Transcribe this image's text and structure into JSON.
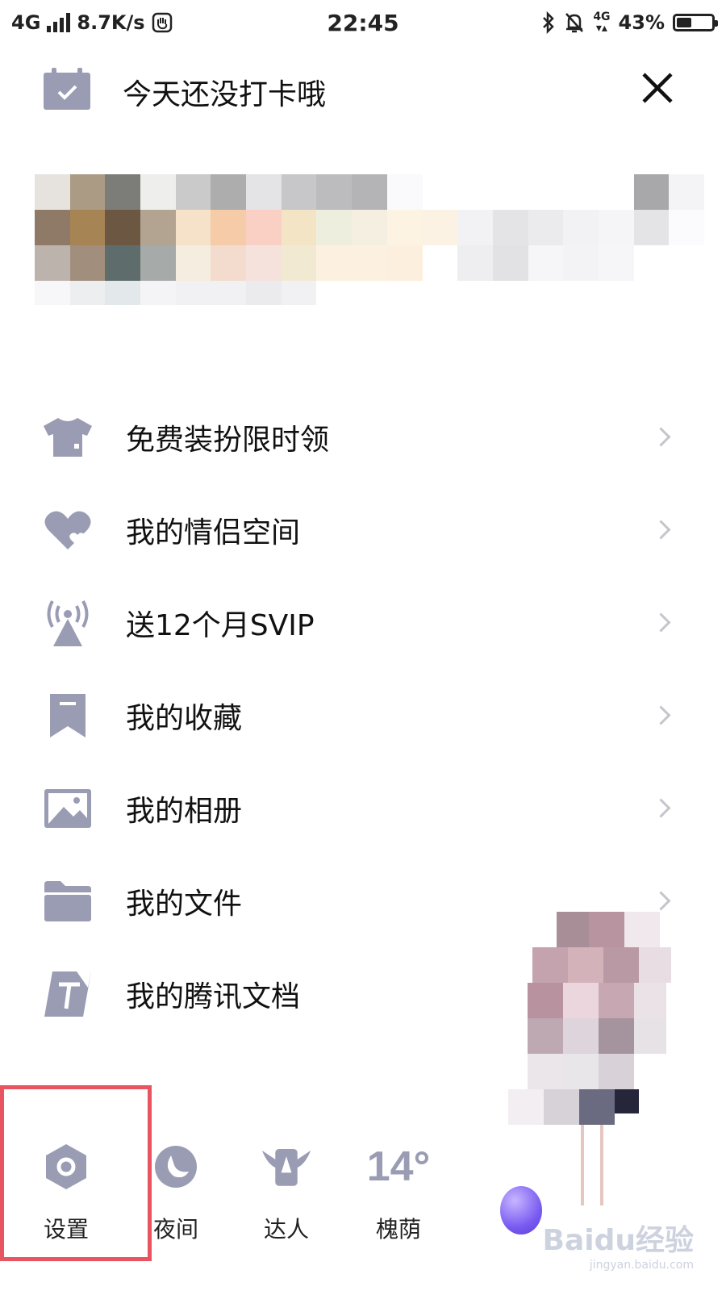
{
  "status_bar": {
    "network": "4G",
    "speed": "8.7K/s",
    "time": "22:45",
    "network_right": "4G",
    "battery_percent": "43%",
    "battery_level": 0.43
  },
  "checkin": {
    "text": "今天还没打卡哦"
  },
  "menu": {
    "items": [
      {
        "label": "免费装扮限时领",
        "icon": "tshirt-icon"
      },
      {
        "label": "我的情侣空间",
        "icon": "heart-icon"
      },
      {
        "label": "送12个月SVIP",
        "icon": "broadcast-icon"
      },
      {
        "label": "我的收藏",
        "icon": "bookmark-icon"
      },
      {
        "label": "我的相册",
        "icon": "image-icon"
      },
      {
        "label": "我的文件",
        "icon": "folder-icon"
      },
      {
        "label": "我的腾讯文档",
        "icon": "document-icon"
      }
    ]
  },
  "bottom_bar": {
    "settings_label": "设置",
    "night_label": "夜间",
    "expert_label": "达人",
    "weather_temp": "14°",
    "weather_city": "槐荫"
  },
  "colors": {
    "icon_gray": "#9a9cb4",
    "highlight_red": "#e8545f",
    "chevron": "#c5c5cc"
  },
  "watermark": {
    "brand": "Baidu经验",
    "url": "jingyan.baidu.com"
  }
}
